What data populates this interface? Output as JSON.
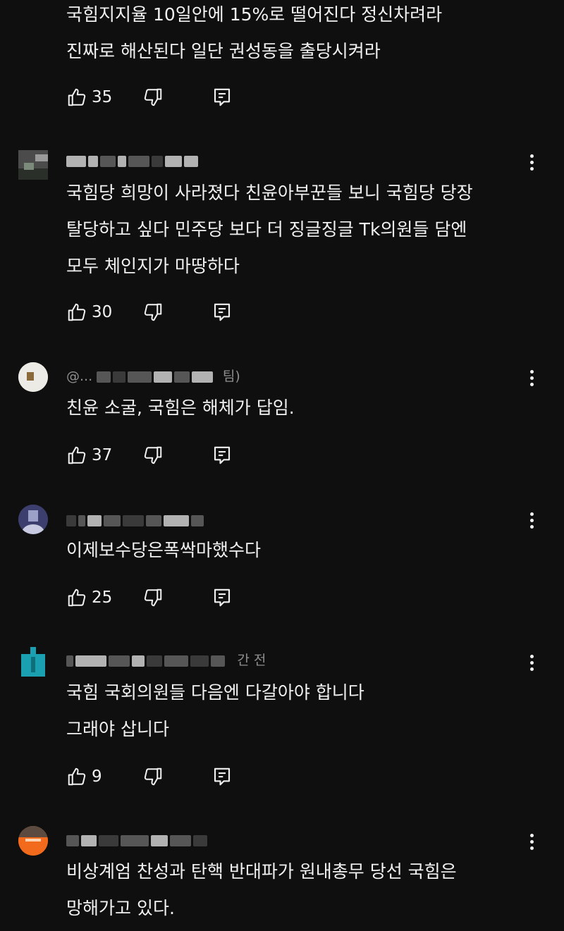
{
  "comments": [
    {
      "header": "",
      "body": [
        "국힘지지율 10일안에 15%로 떨어진다 정신차려라",
        "진짜로 해산된다 일단 권성동을 출당시켜라"
      ],
      "likes": "35"
    },
    {
      "header": "",
      "body": [
        "국힘당 희망이 사라졌다 친윤아부꾼들 보니 국힘당 당장",
        "탈당하고 싶다 민주당 보다 더  징글징글 Tk의원들 담엔",
        "모두 체인지가 마땅하다"
      ],
      "likes": "30"
    },
    {
      "header": "@...",
      "header_tail": "팀)",
      "body": [
        "친윤 소굴, 국힘은 해체가 답임."
      ],
      "likes": "37"
    },
    {
      "header": "",
      "body": [
        "이제보수당은폭싹마했수다"
      ],
      "likes": "25"
    },
    {
      "header": "",
      "header_tail": "간 전",
      "body": [
        "국힘 국회의원들 다음엔 다갈아야 합니다",
        "그래야 삽니다"
      ],
      "likes": "9"
    },
    {
      "header": "",
      "body": [
        "비상계엄 찬성과 탄핵 반대파가 원내총무 당선 국힘은",
        "망해가고 있다."
      ],
      "likes": ""
    }
  ],
  "icons": {
    "like": "thumbs-up-icon",
    "dislike": "thumbs-down-icon",
    "reply": "reply-icon",
    "menu": "more-vertical-icon"
  },
  "colors": {
    "background": "#0f0f0f",
    "text": "#f1f1f1",
    "muted": "#aaaaaa",
    "avatar_orange": "#f26b1d",
    "avatar_cyan": "#1aa0b0",
    "avatar_purple": "#3c3f6e"
  }
}
